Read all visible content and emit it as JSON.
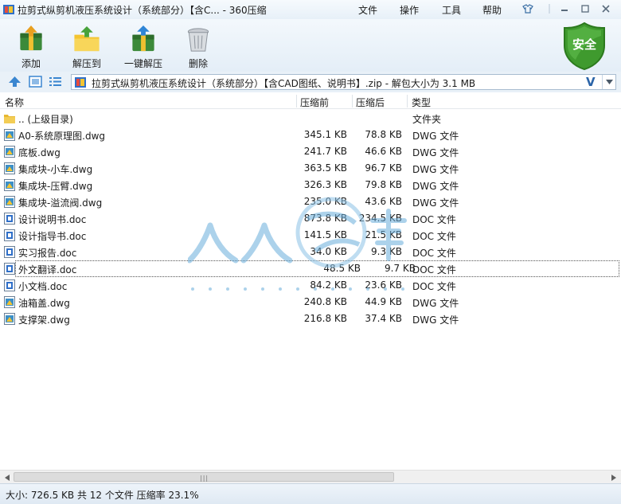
{
  "window": {
    "title": "拉剪式纵剪机液压系统设计（系统部分）【含C... - 360压缩",
    "menu": [
      "文件",
      "操作",
      "工具",
      "帮助"
    ],
    "controls": [
      "skin-icon",
      "minimize-icon",
      "maximize-icon",
      "close-icon"
    ]
  },
  "toolbar": {
    "buttons": [
      {
        "label": "添加",
        "icon": "add-archive-icon"
      },
      {
        "label": "解压到",
        "icon": "extract-to-icon"
      },
      {
        "label": "一键解压",
        "icon": "one-click-extract-icon"
      },
      {
        "label": "删除",
        "icon": "delete-icon"
      }
    ],
    "security_badge": "安全"
  },
  "address": {
    "path": "拉剪式纵剪机液压系统设计（系统部分）【含CAD图纸、说明书】.zip - 解包大小为 3.1 MB",
    "v_label": "V"
  },
  "columns": {
    "name": "名称",
    "packed": "压缩前",
    "original": "压缩后",
    "type": "类型"
  },
  "files": [
    {
      "name": ".. (上级目录)",
      "packed": "",
      "original": "",
      "type": "文件夹",
      "icon": "folder-icon"
    },
    {
      "name": "A0-系统原理图.dwg",
      "packed": "345.1 KB",
      "original": "78.8 KB",
      "type": "DWG 文件",
      "icon": "dwg-file-icon"
    },
    {
      "name": "底板.dwg",
      "packed": "241.7 KB",
      "original": "46.6 KB",
      "type": "DWG 文件",
      "icon": "dwg-file-icon"
    },
    {
      "name": "集成块-小车.dwg",
      "packed": "363.5 KB",
      "original": "96.7 KB",
      "type": "DWG 文件",
      "icon": "dwg-file-icon"
    },
    {
      "name": "集成块-压臂.dwg",
      "packed": "326.3 KB",
      "original": "79.8 KB",
      "type": "DWG 文件",
      "icon": "dwg-file-icon"
    },
    {
      "name": "集成块-溢流阀.dwg",
      "packed": "235.0 KB",
      "original": "43.6 KB",
      "type": "DWG 文件",
      "icon": "dwg-file-icon"
    },
    {
      "name": "设计说明书.doc",
      "packed": "873.8 KB",
      "original": "234.5 KB",
      "type": "DOC 文件",
      "icon": "doc-file-icon"
    },
    {
      "name": "设计指导书.doc",
      "packed": "141.5 KB",
      "original": "21.5 KB",
      "type": "DOC 文件",
      "icon": "doc-file-icon"
    },
    {
      "name": "实习报告.doc",
      "packed": "34.0 KB",
      "original": "9.3 KB",
      "type": "DOC 文件",
      "icon": "doc-file-icon"
    },
    {
      "name": "外文翻译.doc",
      "packed": "48.5 KB",
      "original": "9.7 KB",
      "type": "DOC 文件",
      "icon": "doc-file-icon"
    },
    {
      "name": "小文档.doc",
      "packed": "84.2 KB",
      "original": "23.6 KB",
      "type": "DOC 文件",
      "icon": "doc-file-icon"
    },
    {
      "name": "油箱盖.dwg",
      "packed": "240.8 KB",
      "original": "44.9 KB",
      "type": "DWG 文件",
      "icon": "dwg-file-icon"
    },
    {
      "name": "支撑架.dwg",
      "packed": "216.8 KB",
      "original": "37.4 KB",
      "type": "DWG 文件",
      "icon": "dwg-file-icon"
    }
  ],
  "focused_row": 9,
  "watermark": {
    "logo_text": "人人文库",
    "url_text": "w w w . r e n r e n d o c . c o m"
  },
  "status": "大小: 726.5 KB 共 12 个文件 压缩率 23.1%",
  "colors": {
    "accent": "#2b64a8",
    "shield_green": "#3f9a2e",
    "folder": "#e8b830",
    "dwg": "#3c8fc7",
    "doc": "#2f6fc9"
  }
}
